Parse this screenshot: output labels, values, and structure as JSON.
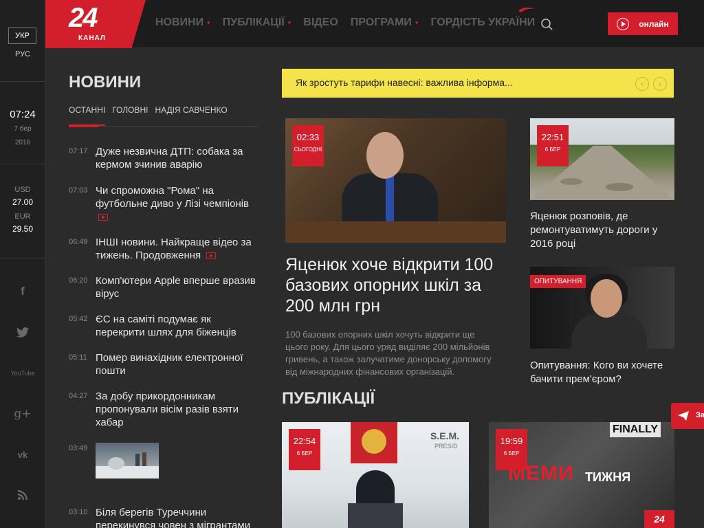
{
  "rail": {
    "lang_active": "УКР",
    "lang_alt": "РУС",
    "time": "07:24",
    "date": "7 бер",
    "year": "2016",
    "usd_label": "USD",
    "usd_value": "27.00",
    "eur_label": "EUR",
    "eur_value": "29.50",
    "social": {
      "facebook": "f",
      "youtube": "YouTube",
      "gplus": "g+",
      "vk": "vk"
    }
  },
  "header": {
    "logo_number": "24",
    "logo_sub": "КАНАЛ",
    "nav": [
      "НОВИНИ",
      "ПУБЛІКАЦІЇ",
      "ВІДЕО",
      "ПРОГРАМИ",
      "ГОРДІСТЬ УКРАЇНИ"
    ],
    "online_label": "онлайн"
  },
  "news": {
    "title": "НОВИНИ",
    "tabs": [
      "ОСТАННІ",
      "ГОЛОВНІ",
      "НАДІЯ САВЧЕНКО"
    ],
    "items": [
      {
        "time": "07:17",
        "text": "Дуже незвична ДТП: собака за кермом зчинив аварію"
      },
      {
        "time": "07:03",
        "text": "Чи спроможна \"Рома\" на футбольне диво у Лізі чемпіонів"
      },
      {
        "time": "06:49",
        "text": "ІНШІ новини. Найкраще відео за тижень. Продовження"
      },
      {
        "time": "06:20",
        "text": "Комп'ютери Apple вперше вразив вірус"
      },
      {
        "time": "05:42",
        "text": "ЄС на саміті подумає як перекрити шлях для біженців"
      },
      {
        "time": "05:11",
        "text": "Помер винахідник електронної пошти"
      },
      {
        "time": "04:27",
        "text": "За добу прикордонникам пропонували вісім разів взяти хабар"
      },
      {
        "time": "03:49",
        "text": ""
      },
      {
        "time": "03:10",
        "text": "Біля берегів Туреччини перекинувся човен з мігрантами"
      }
    ]
  },
  "ticker": {
    "text": "Як зростуть тарифи навесні: важлива інформа...",
    "prev": "‹",
    "next": "›"
  },
  "main_article": {
    "time": "02:33",
    "day": "СЬОГОДНІ",
    "headline": "Яценюк хоче відкрити 100 базових опорних шкіл за 200 млн грн",
    "lead": "100 базових опорних шкіл хочуть відкрити ще цього року. Для цього уряд виділяє 200 мільйонів гривень, а також залучатиме донорську допомогу від міжнародних фінансових організацій."
  },
  "side_articles": [
    {
      "time": "22:51",
      "day": "6 БЕР",
      "headline": "Яценюк розповів, де ремонтуватимуть дороги у 2016 році"
    },
    {
      "tag": "ОПИТУВАННЯ",
      "headline": "Опитування: Кого ви хочете бачити прем'єром?"
    }
  ],
  "publications": {
    "title": "ПУБЛІКАЦІЇ",
    "cards": [
      {
        "time": "22:54",
        "day": "6 БЕР",
        "sign": "S.E.M.",
        "sign_sub": "PRESID"
      },
      {
        "time": "19:59",
        "day": "6 БЕР",
        "word1": "МЕМИ",
        "word2": "ТИЖНЯ",
        "sign": "FINALLY",
        "logo": "24"
      }
    ]
  },
  "float_send": {
    "label": "За"
  }
}
